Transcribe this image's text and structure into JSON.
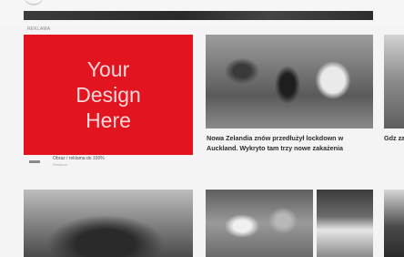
{
  "section": {
    "label": "Reklama"
  },
  "ad": {
    "lines": [
      "Your",
      "Design",
      "Here"
    ],
    "meta_title": "Obraz / reklama do 100%",
    "meta_sub": "Reklama",
    "color": "#e1141f"
  },
  "articles": [
    {
      "headline": "Nowa Zelandia znów przedłużył lockdown w Auckland. Wykryto tam trzy nowe zakażenia"
    },
    {
      "headline": "Gdz za n ob..."
    }
  ]
}
